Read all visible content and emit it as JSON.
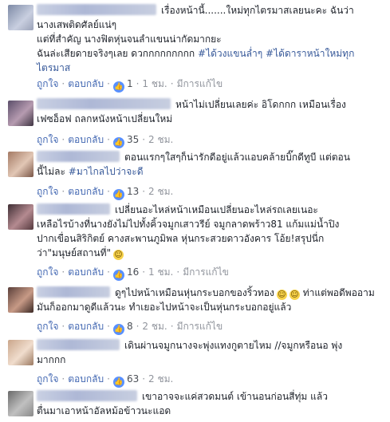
{
  "comments": [
    {
      "lines": [
        "เรื่องหน้านี้.......ใหม่ทุกไตรมาสเลยนะคะ ฉันว่า",
        "นางเสพติดศัลย์แน่ๆ",
        "แต่ที่สำคัญ นางฟิตหุ่นจนลำแขนน่ากัดมากยะ",
        "ฉันล่ะเสียดายจริงๆเลย ดวกกกกกกกกก",
        "ไตรมาส"
      ],
      "hashtags": [
        "#ได้วงแขนล่ำๆ",
        "#ได้ดาราหน้าใหม่ทุก"
      ],
      "actions": {
        "like": "ถูกใจ",
        "reply": "ตอบกลับ",
        "count": "1",
        "time": "1 ชม.",
        "edited": "มีการแก้ไข"
      }
    },
    {
      "lines": [
        "หน้าไม่เปลี่ยนเลยค่ะ อิโดกกก เหมือนเรื่อง",
        "เฟซอ็อฟ ถลกหนังหน้าเปลี่ยนใหม่"
      ],
      "actions": {
        "like": "ถูกใจ",
        "reply": "ตอบกลับ",
        "count": "35",
        "time": "2 ชม."
      }
    },
    {
      "lines": [
        "ตอนแรกๆใสๆก็น่ารักดีอยู่แล้วแอบคล้ายบิ๊กดีทูบี แต่ตอน",
        "นี้ไม่ละ"
      ],
      "hashtags": [
        "#มาไกลไปว่าจะดี"
      ],
      "actions": {
        "like": "ถูกใจ",
        "reply": "ตอบกลับ",
        "count": "13",
        "time": "2 ชม."
      }
    },
    {
      "lines": [
        "เปลี่ยนอะไหล่หน้าเหมือนเปลี่ยนอะไหล่รถเลยเนอะ",
        "เหลือไรบ้างที่นางยังไม่ไปทั้งคิ้วจมูกเสาวรีย์ จมูกลาดพร้าว81 แก้มแม่น้ำปิง",
        "ปากเขื่อนสิริกิตย์ คางสะพานภูมิพล หุ่นกระสวยดาวอังคาร โอ้ย!สรุปนี่ก",
        "ว่า\"มนุษย์สถานที่\""
      ],
      "actions": {
        "like": "ถูกใจ",
        "reply": "ตอบกลับ",
        "count": "16",
        "time": "1 ชม.",
        "edited": "มีการแก้ไข"
      }
    },
    {
      "lines": [
        "ดูๆไปหน้าเหมือนหุ่นกระบอกของริ้วทอง",
        "ท่าแต่พอดีพออาม",
        "มันก็ออกมาดูดีแล้วนะ ทำเยอะไปหน้าจะเป็นหุ่นกระบอกอยู่แล้ว"
      ],
      "actions": {
        "like": "ถูกใจ",
        "reply": "ตอบกลับ",
        "count": "8",
        "time": "2 ชม.",
        "edited": "มีการแก้ไข"
      }
    },
    {
      "lines": [
        "เดินผ่านจมูกนางจะพุ่งแทงกูตายไหม //จมูกหรือนอ พุ่ง",
        "มากกก"
      ],
      "actions": {
        "like": "ถูกใจ",
        "reply": "ตอบกลับ",
        "count": "63",
        "time": "2 ชม."
      }
    },
    {
      "lines": [
        "เขาอาจจะแค่สวดมนต์ เข้านอนก่อนสี่ทุ่ม แล้ว",
        "ตื่นมาเอาหน้าอัลหม้อข้าวนะแอด"
      ]
    }
  ],
  "colors": {
    "link": "#4267b2",
    "like_badge": "#5890ff",
    "meta": "#90949c",
    "hashtag": "#365899"
  },
  "icons": {
    "like_badge": "thumbs-up-icon",
    "emoji": "smile-emoji-icon"
  }
}
